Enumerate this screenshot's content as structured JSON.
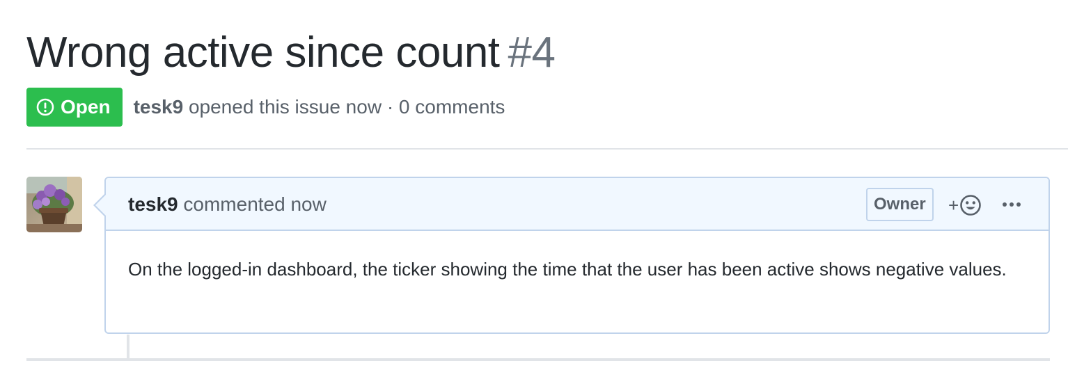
{
  "issue": {
    "title": "Wrong active since count",
    "number": "#4",
    "state": "Open",
    "state_color": "#2cbe4e",
    "state_icon": "issue-opened-icon",
    "author": "tesk9",
    "meta_text": "opened this issue now · 0 comments"
  },
  "comment": {
    "author": "tesk9",
    "action_text": "commented now",
    "role_label": "Owner",
    "reaction_plus": "+",
    "reaction_icon": "smiley-icon",
    "more_icon": "kebab-horizontal-icon",
    "body": "On the logged-in dashboard, the ticker showing the time that the user has been active shows negative values.",
    "header_bg": "#f1f8ff",
    "border_color": "#c0d3eb",
    "avatar_icon": "flower-pot-avatar"
  }
}
